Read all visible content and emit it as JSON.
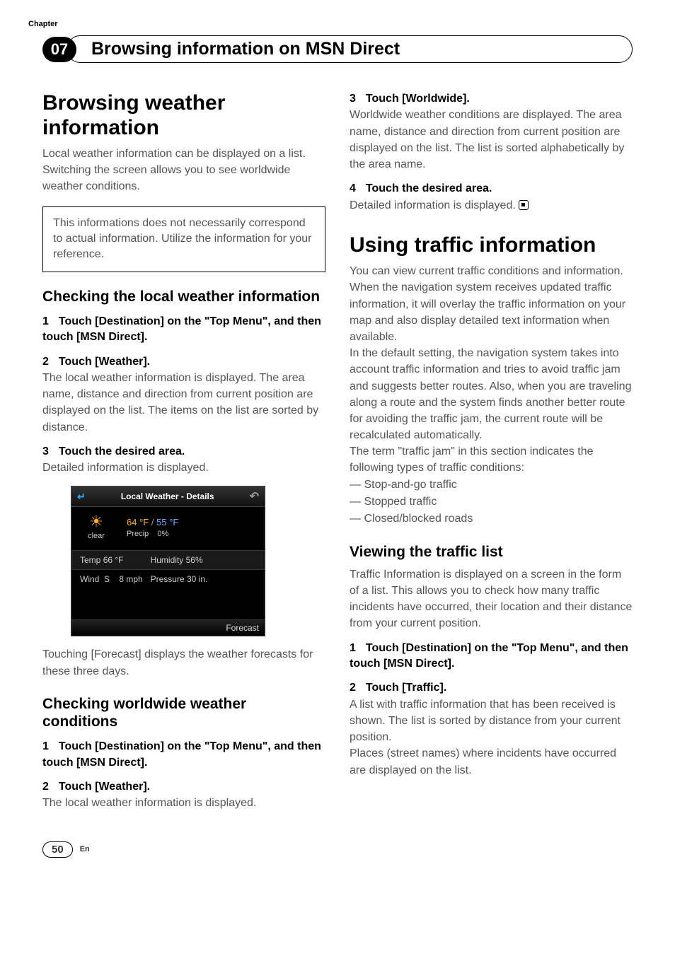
{
  "chapter_label": "Chapter",
  "chapter_num": "07",
  "header_title": "Browsing information on MSN Direct",
  "col1": {
    "h1": "Browsing weather information",
    "intro": "Local weather information can be displayed on a list. Switching the screen allows you to see worldwide weather conditions.",
    "note": "This informations does not necessarily correspond to actual information. Utilize the information for your reference.",
    "sec1_h2": "Checking the local weather information",
    "sec1_step1": "Touch [Destination] on the \"Top Menu\", and then touch [MSN Direct].",
    "sec1_step2_title": "Touch [Weather].",
    "sec1_step2_body": "The local weather information is displayed. The area name, distance and direction from current position are displayed on the list. The items on the list are sorted by distance.",
    "sec1_step3_title": "Touch the desired area.",
    "sec1_step3_body": "Detailed information is displayed.",
    "forecast_note_a": "Touching [",
    "forecast_bold": "Forecast",
    "forecast_note_b": "] displays the weather forecasts for these three days.",
    "sec2_h2": "Checking worldwide weather conditions",
    "sec2_step1": "Touch [Destination] on the \"Top Menu\", and then touch [MSN Direct].",
    "sec2_step2_title": "Touch [Weather].",
    "sec2_step2_body": "The local weather information is displayed."
  },
  "screenshot": {
    "title": "Local Weather - Details",
    "condition": "clear",
    "hi": "64 °F",
    "lo": "55 °F",
    "precip_label": "Precip",
    "precip_val": "0%",
    "temp_label": "Temp",
    "temp_val": "66 °F",
    "hum_label": "Humidity",
    "hum_val": "56%",
    "wind_label": "Wind",
    "wind_dir": "S",
    "wind_speed": "8 mph",
    "press_label": "Pressure",
    "press_val": "30 in.",
    "forecast_btn": "Forecast"
  },
  "col2": {
    "step3_title": "Touch [Worldwide].",
    "step3_body": "Worldwide weather conditions are displayed. The area name, distance and direction from current position are displayed on the list. The list is sorted alphabetically by the area name.",
    "step4_title": "Touch the desired area.",
    "step4_body": "Detailed information is displayed.",
    "h1": "Using traffic information",
    "intro_a": "You can view current traffic conditions and information. When the navigation system receives updated traffic information, it will overlay the traffic information on your map and also display detailed text information when available.",
    "intro_b": "In the default setting, the navigation system takes into account traffic information and tries to avoid traffic jam and suggests better routes. Also, when you are traveling along a route and the system finds another better route for avoiding the traffic jam, the current route will be recalculated automatically.",
    "intro_c": "The term \"traffic jam\" in this section indicates the following types of traffic conditions:",
    "bullet1": "— Stop-and-go traffic",
    "bullet2": "— Stopped traffic",
    "bullet3": "— Closed/blocked roads",
    "sec_h2": "Viewing the traffic list",
    "sec_intro": "Traffic Information is displayed on a screen in the form of a list. This allows you to check how many traffic incidents have occurred, their location and their distance from your current position.",
    "step1": "Touch [Destination] on the \"Top Menu\", and then touch [MSN Direct].",
    "step2_title": "Touch [Traffic].",
    "step2_body_a": "A list with traffic information that has been received is shown. The list is sorted by distance from your current position.",
    "step2_body_b": "Places (street names) where incidents have occurred are displayed on the list."
  },
  "page_num": "50",
  "lang": "En"
}
